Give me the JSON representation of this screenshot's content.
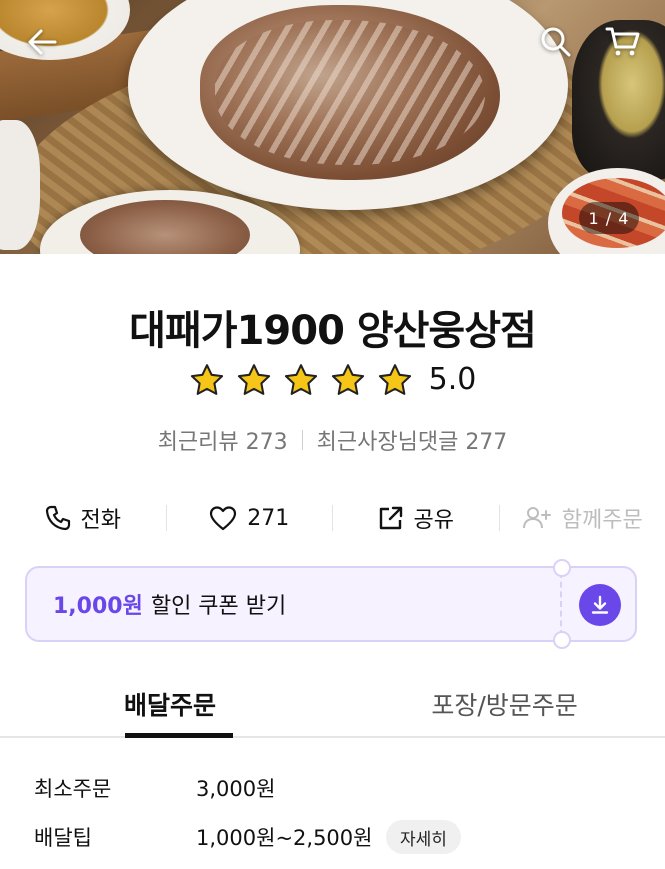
{
  "hero": {
    "pager": "1 / 4",
    "back_icon": "arrow-left-icon",
    "search_icon": "search-icon",
    "cart_icon": "cart-icon"
  },
  "store": {
    "name": "대패가1900 양산웅상점",
    "rating": "5.0",
    "stars": 5,
    "recent_reviews": "최근리뷰 273",
    "owner_replies": "최근사장님댓글 277"
  },
  "actions": {
    "call": "전화",
    "likes": "271",
    "share": "공유",
    "group_order": "함께주문"
  },
  "coupon": {
    "amount": "1,000원",
    "label": "할인 쿠폰 받기"
  },
  "tabs": [
    {
      "label": "배달주문",
      "active": true
    },
    {
      "label": "포장/방문주문",
      "active": false
    }
  ],
  "info": {
    "min_order_label": "최소주문",
    "min_order_value": "3,000원",
    "delivery_tip_label": "배달팁",
    "delivery_tip_value": "1,000원~2,500원",
    "detail_button": "자세히"
  },
  "colors": {
    "accent": "#6a47e8",
    "star": "#f5c518"
  }
}
